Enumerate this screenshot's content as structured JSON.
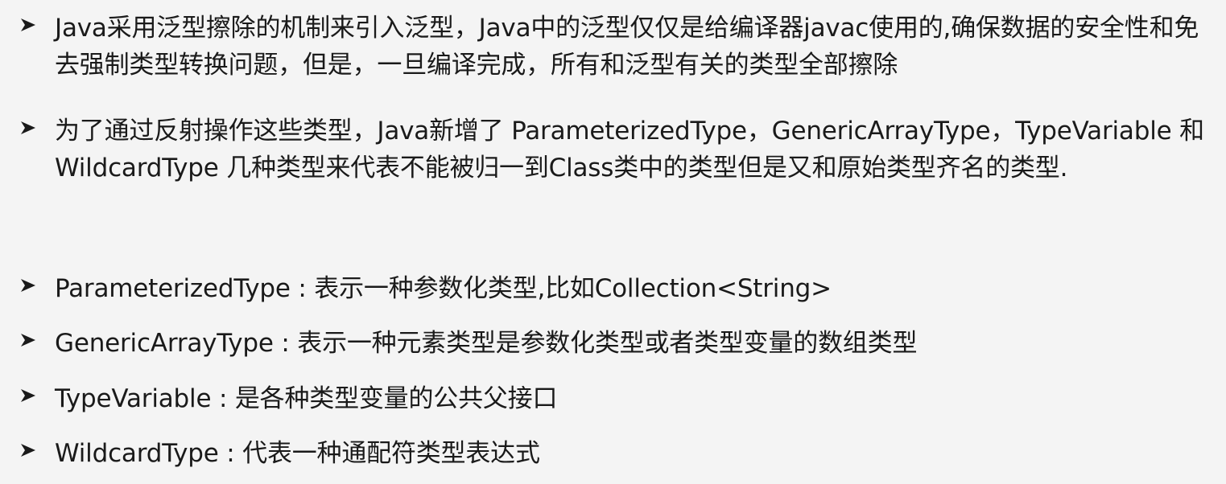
{
  "bullets": [
    {
      "text": "Java采用泛型擦除的机制来引入泛型，Java中的泛型仅仅是给编译器javac使用的,确保数据的安全性和免去强制类型转换问题，但是，一旦编译完成，所有和泛型有关的类型全部擦除"
    },
    {
      "text": "为了通过反射操作这些类型，Java新增了 ParameterizedType，GenericArrayType，TypeVariable 和 WildcardType 几种类型来代表不能被归一到Class类中的类型但是又和原始类型齐名的类型."
    },
    {
      "text": "ParameterizedType : 表示一种参数化类型,比如Collection<String>"
    },
    {
      "text": "GenericArrayType : 表示一种元素类型是参数化类型或者类型变量的数组类型"
    },
    {
      "text": "TypeVariable : 是各种类型变量的公共父接口"
    },
    {
      "text": "WildcardType : 代表一种通配符类型表达式"
    }
  ],
  "bullet_icon": "arrowhead-bullet-icon"
}
